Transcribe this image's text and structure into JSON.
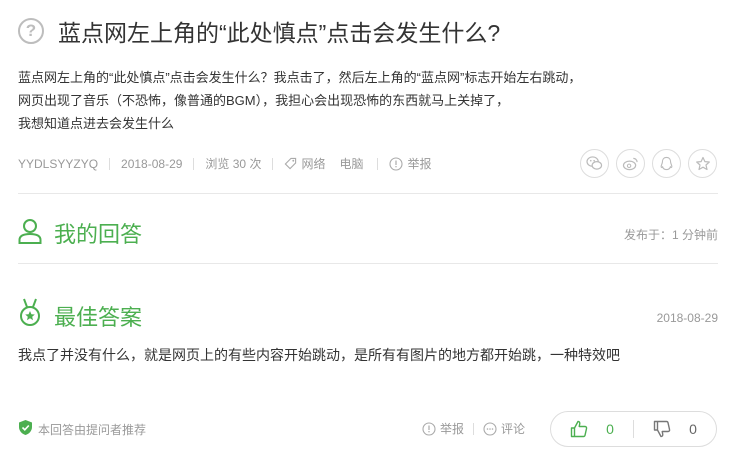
{
  "question": {
    "title": "蓝点网左上角的“此处慎点”点击会发生什么?",
    "body_lines": [
      "蓝点网左上角的“此处慎点”点击会发生什么？我点击了，然后左上角的“蓝点网”标志开始左右跳动，",
      "网页出现了音乐（不恐怖，像普通的BGM），我担心会出现恐怖的东西就马上关掉了，",
      "我想知道点进去会发生什么"
    ],
    "author": "YYDLSYYZYQ",
    "date": "2018-08-29",
    "views": "浏览 30 次",
    "tags": [
      "网络",
      "电脑"
    ],
    "report_label": "举报"
  },
  "share_icons": [
    "wechat-icon",
    "weibo-icon",
    "qq-icon",
    "qzone-icon"
  ],
  "my_answer": {
    "heading": "我的回答",
    "published": "发布于：1 分钟前"
  },
  "best_answer": {
    "heading": "最佳答案",
    "date": "2018-08-29",
    "text": "我点了并没有什么，就是网页上的有些内容开始跳动，是所有有图片的地方都开始跳，一种特效吧",
    "recommend_note": "本回答由提问者推荐",
    "report_label": "举报",
    "comment_label": "评论",
    "upvotes": "0",
    "downvotes": "0"
  },
  "colors": {
    "accent": "#4caf50",
    "muted": "#999999",
    "border": "#dddddd"
  }
}
